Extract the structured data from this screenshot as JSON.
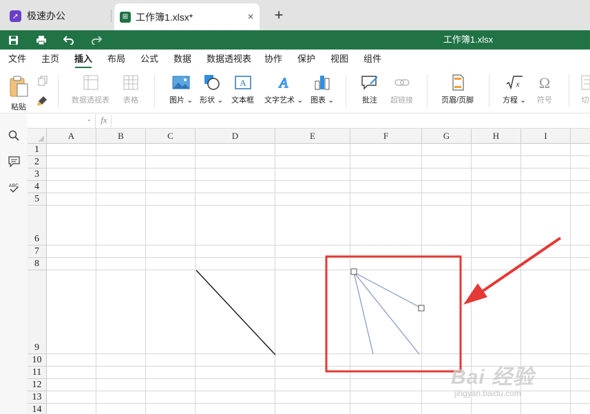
{
  "tabs": {
    "app_tab_label": "极速办公",
    "doc_tab_label": "工作簿1.xlsx*",
    "close_glyph": "×",
    "new_tab_glyph": "+"
  },
  "title_bar": {
    "title": "工作簿1.xlsx",
    "accent_color": "#217346"
  },
  "menu": {
    "items": [
      "文件",
      "主页",
      "插入",
      "布局",
      "公式",
      "数据",
      "数据透视表",
      "协作",
      "保护",
      "视图",
      "组件"
    ],
    "active_index": 2
  },
  "ribbon": {
    "paste_label": "粘贴",
    "pivot_label": "数据透视表",
    "table_label": "表格",
    "image_label": "图片",
    "shape_label": "形状",
    "textbox_label": "文本框",
    "wordart_label": "文字艺术",
    "chart_label": "图表",
    "comment_label": "批注",
    "hyperlink_label": "超链接",
    "headerfooter_label": "页眉/页脚",
    "equation_label": "方程",
    "symbol_label": "符号",
    "slicer_label": "切",
    "dropdown_glyph": "⌄",
    "icons": [
      "paste-icon",
      "copy-icon",
      "format-painter-icon",
      "pivot-table-icon",
      "table-icon",
      "image-icon",
      "shape-icon",
      "textbox-icon",
      "wordart-icon",
      "chart-icon",
      "comment-icon",
      "hyperlink-icon",
      "header-footer-icon",
      "equation-icon",
      "symbol-icon",
      "slicer-icon"
    ]
  },
  "formula_bar": {
    "name_box_value": "",
    "fx_label": "fx",
    "formula_value": ""
  },
  "sidebar": {
    "icons": [
      "search-icon",
      "comment-icon",
      "spellcheck-icon"
    ]
  },
  "sheet": {
    "columns": [
      "A",
      "B",
      "C",
      "D",
      "E",
      "F",
      "G",
      "H",
      "I"
    ],
    "rows": [
      "1",
      "2",
      "3",
      "4",
      "5",
      "6",
      "7",
      "8",
      "9",
      "10",
      "11",
      "12",
      "13",
      "14"
    ]
  },
  "annotation": {
    "highlight_color": "#e53935",
    "shape_color": "#7f96c4"
  },
  "watermark": {
    "line1": "Bai 经验",
    "line2": "jingyan.baidu.com"
  }
}
